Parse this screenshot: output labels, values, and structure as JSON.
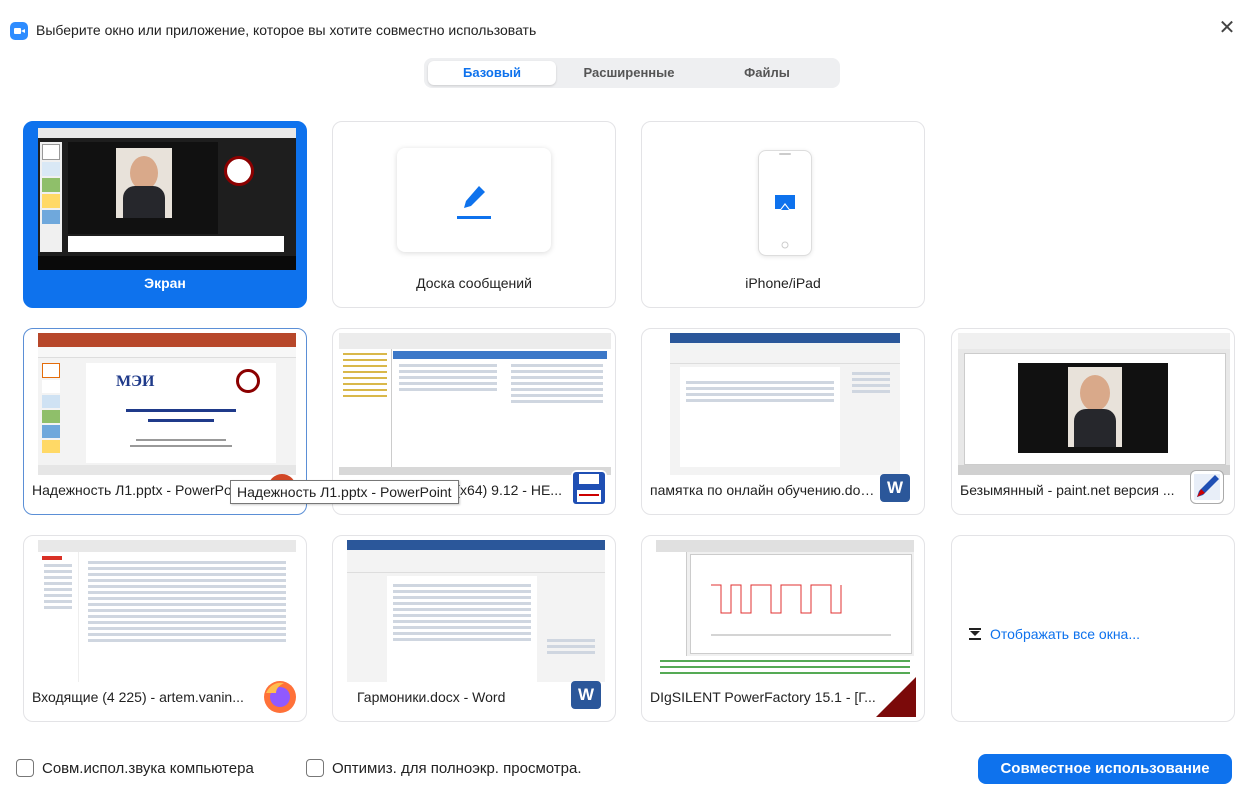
{
  "window": {
    "title": "Выберите окно или приложение, которое вы хотите совместно использовать",
    "close_glyph": "✕"
  },
  "tabs": [
    {
      "label": "Базовый",
      "active": true
    },
    {
      "label": "Расширенные",
      "active": false
    },
    {
      "label": "Файлы",
      "active": false
    }
  ],
  "top_tiles": [
    {
      "label": "Экран",
      "selected": true
    },
    {
      "label": "Доска сообщений",
      "selected": false
    },
    {
      "label": "iPhone/iPad",
      "selected": false
    }
  ],
  "windows": [
    {
      "label": "Надежность Л1.pptx - PowerPoint",
      "icon": "powerpoint-icon"
    },
    {
      "label": "Total Commander (x64) 9.12 - HE...",
      "icon": "total-commander-icon"
    },
    {
      "label": "памятка по онлайн обучению.docx - Word",
      "icon": "word-icon"
    },
    {
      "label": "Безымянный - paint.net версия ...",
      "icon": "paint-net-icon"
    },
    {
      "label": "Входящие (4 225) - artem.vanin...",
      "icon": "firefox-icon"
    },
    {
      "label": "Гармоники.docx - Word",
      "icon": "word-icon"
    },
    {
      "label": "DIgSILENT PowerFactory 15.1 - [Г...",
      "icon": "powerfactory-icon"
    }
  ],
  "tooltip": "Надежность Л1.pptx - PowerPoint",
  "show_all": "Отображать все окна...",
  "options": {
    "share_sound": "Совм.испол.звука компьютера",
    "optimize_fullscreen": "Оптимиз. для полноэкр. просмотра."
  },
  "share_button": "Совместное использование",
  "colors": {
    "accent": "#0e72ed",
    "border": "#e3e3e6",
    "ppt_red": "#d24726",
    "word_blue": "#2b579a"
  }
}
